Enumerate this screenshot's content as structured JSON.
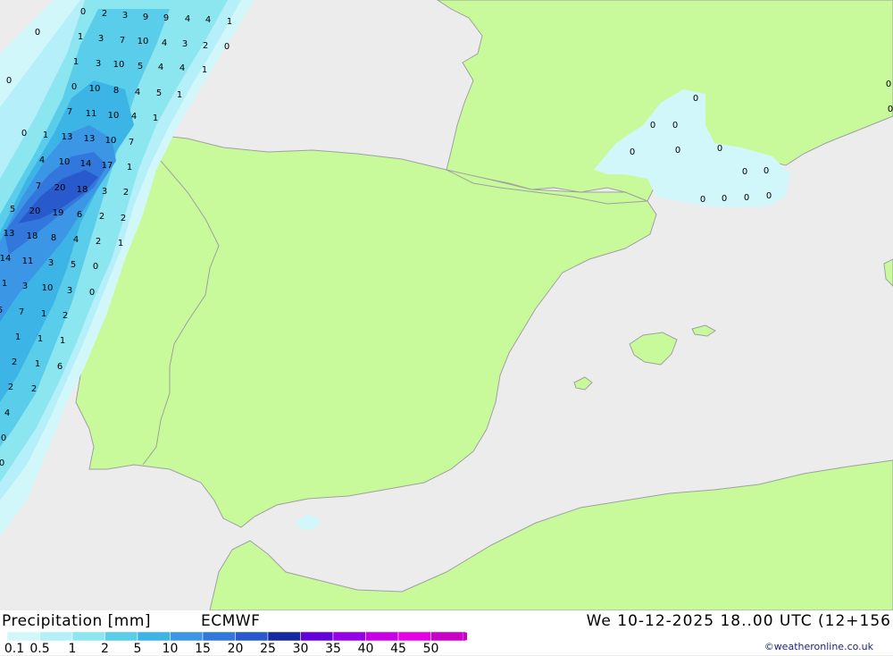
{
  "footer": {
    "title": "Precipitation [mm]",
    "model": "ECMWF",
    "datetime": "We 10-12-2025 18..00 UTC (12+156",
    "credit": "©weatheronline.co.uk"
  },
  "legend": {
    "labels": [
      "0.1",
      "0.5",
      "1",
      "2",
      "5",
      "10",
      "15",
      "20",
      "25",
      "30",
      "35",
      "40",
      "45",
      "50"
    ],
    "colors": [
      "#d2f7fa",
      "#b4effa",
      "#8ce6f0",
      "#5acdeb",
      "#3cb4e6",
      "#3c96e6",
      "#3278dc",
      "#285acd",
      "#1428a0",
      "#6400dc",
      "#9600e6",
      "#c800e6",
      "#e600e6",
      "#c800c8"
    ]
  },
  "colors": {
    "land": "#c8fa9b",
    "sea": "#ececec",
    "border": "#a0a0a0"
  },
  "values": [
    "0",
    "2",
    "3",
    "9",
    "9",
    "4",
    "4",
    "1",
    "0",
    "1",
    "3",
    "7",
    "10",
    "4",
    "3",
    "2",
    "0",
    "1",
    "3",
    "10",
    "5",
    "4",
    "4",
    "1",
    "0",
    "0",
    "10",
    "8",
    "4",
    "5",
    "1",
    "7",
    "11",
    "10",
    "4",
    "1",
    "0",
    "1",
    "13",
    "13",
    "10",
    "7",
    "4",
    "10",
    "14",
    "17",
    "1",
    "7",
    "20",
    "18",
    "3",
    "2",
    "5",
    "20",
    "19",
    "6",
    "2",
    "2",
    "13",
    "18",
    "8",
    "4",
    "2",
    "1",
    "14",
    "11",
    "3",
    "5",
    "0",
    "1",
    "3",
    "10",
    "3",
    "0",
    "5",
    "7",
    "1",
    "2",
    "1",
    "1",
    "1",
    "2",
    "1",
    "6",
    "2",
    "2",
    "4",
    "0",
    "0",
    "0",
    "0",
    "0",
    "0",
    "0",
    "0",
    "0",
    "0",
    "0",
    "0",
    "0",
    "0",
    "0",
    "0"
  ]
}
